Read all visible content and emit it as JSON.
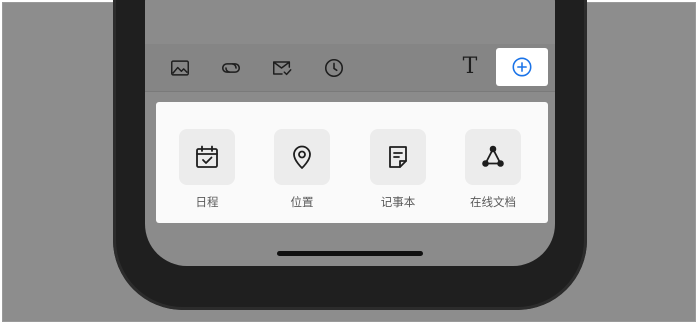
{
  "toolbar": {
    "icons": [
      "image-icon",
      "link-icon",
      "mail-check-icon",
      "clock-icon"
    ],
    "text_format_label": "T",
    "add_icon": "plus-circle-icon",
    "accent_color": "#1a73e8"
  },
  "insert_panel": {
    "items": [
      {
        "label": "日程",
        "icon": "calendar-check-icon"
      },
      {
        "label": "位置",
        "icon": "location-pin-icon"
      },
      {
        "label": "记事本",
        "icon": "notepad-icon"
      },
      {
        "label": "在线文档",
        "icon": "share-nodes-icon"
      }
    ]
  }
}
